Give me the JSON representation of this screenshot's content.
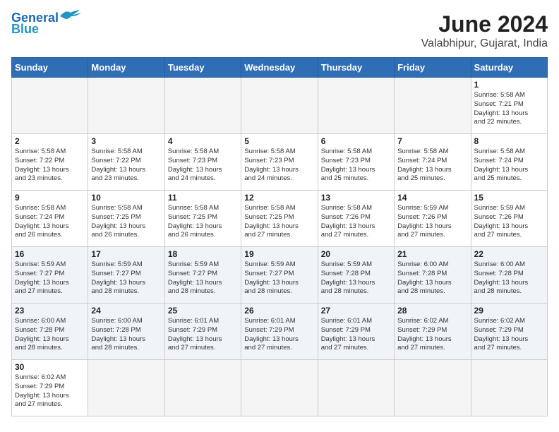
{
  "logo": {
    "line1": "General",
    "line2": "Blue"
  },
  "title": "June 2024",
  "subtitle": "Valabhipur, Gujarat, India",
  "weekdays": [
    "Sunday",
    "Monday",
    "Tuesday",
    "Wednesday",
    "Thursday",
    "Friday",
    "Saturday"
  ],
  "days": [
    {
      "num": "",
      "info": ""
    },
    {
      "num": "",
      "info": ""
    },
    {
      "num": "",
      "info": ""
    },
    {
      "num": "",
      "info": ""
    },
    {
      "num": "",
      "info": ""
    },
    {
      "num": "",
      "info": ""
    },
    {
      "num": "1",
      "info": "Sunrise: 5:58 AM\nSunset: 7:21 PM\nDaylight: 13 hours\nand 22 minutes."
    },
    {
      "num": "2",
      "info": "Sunrise: 5:58 AM\nSunset: 7:22 PM\nDaylight: 13 hours\nand 23 minutes."
    },
    {
      "num": "3",
      "info": "Sunrise: 5:58 AM\nSunset: 7:22 PM\nDaylight: 13 hours\nand 23 minutes."
    },
    {
      "num": "4",
      "info": "Sunrise: 5:58 AM\nSunset: 7:23 PM\nDaylight: 13 hours\nand 24 minutes."
    },
    {
      "num": "5",
      "info": "Sunrise: 5:58 AM\nSunset: 7:23 PM\nDaylight: 13 hours\nand 24 minutes."
    },
    {
      "num": "6",
      "info": "Sunrise: 5:58 AM\nSunset: 7:23 PM\nDaylight: 13 hours\nand 25 minutes."
    },
    {
      "num": "7",
      "info": "Sunrise: 5:58 AM\nSunset: 7:24 PM\nDaylight: 13 hours\nand 25 minutes."
    },
    {
      "num": "8",
      "info": "Sunrise: 5:58 AM\nSunset: 7:24 PM\nDaylight: 13 hours\nand 25 minutes."
    },
    {
      "num": "9",
      "info": "Sunrise: 5:58 AM\nSunset: 7:24 PM\nDaylight: 13 hours\nand 26 minutes."
    },
    {
      "num": "10",
      "info": "Sunrise: 5:58 AM\nSunset: 7:25 PM\nDaylight: 13 hours\nand 26 minutes."
    },
    {
      "num": "11",
      "info": "Sunrise: 5:58 AM\nSunset: 7:25 PM\nDaylight: 13 hours\nand 26 minutes."
    },
    {
      "num": "12",
      "info": "Sunrise: 5:58 AM\nSunset: 7:25 PM\nDaylight: 13 hours\nand 27 minutes."
    },
    {
      "num": "13",
      "info": "Sunrise: 5:58 AM\nSunset: 7:26 PM\nDaylight: 13 hours\nand 27 minutes."
    },
    {
      "num": "14",
      "info": "Sunrise: 5:59 AM\nSunset: 7:26 PM\nDaylight: 13 hours\nand 27 minutes."
    },
    {
      "num": "15",
      "info": "Sunrise: 5:59 AM\nSunset: 7:26 PM\nDaylight: 13 hours\nand 27 minutes."
    },
    {
      "num": "16",
      "info": "Sunrise: 5:59 AM\nSunset: 7:27 PM\nDaylight: 13 hours\nand 27 minutes."
    },
    {
      "num": "17",
      "info": "Sunrise: 5:59 AM\nSunset: 7:27 PM\nDaylight: 13 hours\nand 28 minutes."
    },
    {
      "num": "18",
      "info": "Sunrise: 5:59 AM\nSunset: 7:27 PM\nDaylight: 13 hours\nand 28 minutes."
    },
    {
      "num": "19",
      "info": "Sunrise: 5:59 AM\nSunset: 7:27 PM\nDaylight: 13 hours\nand 28 minutes."
    },
    {
      "num": "20",
      "info": "Sunrise: 5:59 AM\nSunset: 7:28 PM\nDaylight: 13 hours\nand 28 minutes."
    },
    {
      "num": "21",
      "info": "Sunrise: 6:00 AM\nSunset: 7:28 PM\nDaylight: 13 hours\nand 28 minutes."
    },
    {
      "num": "22",
      "info": "Sunrise: 6:00 AM\nSunset: 7:28 PM\nDaylight: 13 hours\nand 28 minutes."
    },
    {
      "num": "23",
      "info": "Sunrise: 6:00 AM\nSunset: 7:28 PM\nDaylight: 13 hours\nand 28 minutes."
    },
    {
      "num": "24",
      "info": "Sunrise: 6:00 AM\nSunset: 7:28 PM\nDaylight: 13 hours\nand 28 minutes."
    },
    {
      "num": "25",
      "info": "Sunrise: 6:01 AM\nSunset: 7:29 PM\nDaylight: 13 hours\nand 27 minutes."
    },
    {
      "num": "26",
      "info": "Sunrise: 6:01 AM\nSunset: 7:29 PM\nDaylight: 13 hours\nand 27 minutes."
    },
    {
      "num": "27",
      "info": "Sunrise: 6:01 AM\nSunset: 7:29 PM\nDaylight: 13 hours\nand 27 minutes."
    },
    {
      "num": "28",
      "info": "Sunrise: 6:02 AM\nSunset: 7:29 PM\nDaylight: 13 hours\nand 27 minutes."
    },
    {
      "num": "29",
      "info": "Sunrise: 6:02 AM\nSunset: 7:29 PM\nDaylight: 13 hours\nand 27 minutes."
    },
    {
      "num": "30",
      "info": "Sunrise: 6:02 AM\nSunset: 7:29 PM\nDaylight: 13 hours\nand 27 minutes."
    },
    {
      "num": "",
      "info": ""
    },
    {
      "num": "",
      "info": ""
    },
    {
      "num": "",
      "info": ""
    },
    {
      "num": "",
      "info": ""
    },
    {
      "num": "",
      "info": ""
    },
    {
      "num": "",
      "info": ""
    }
  ]
}
